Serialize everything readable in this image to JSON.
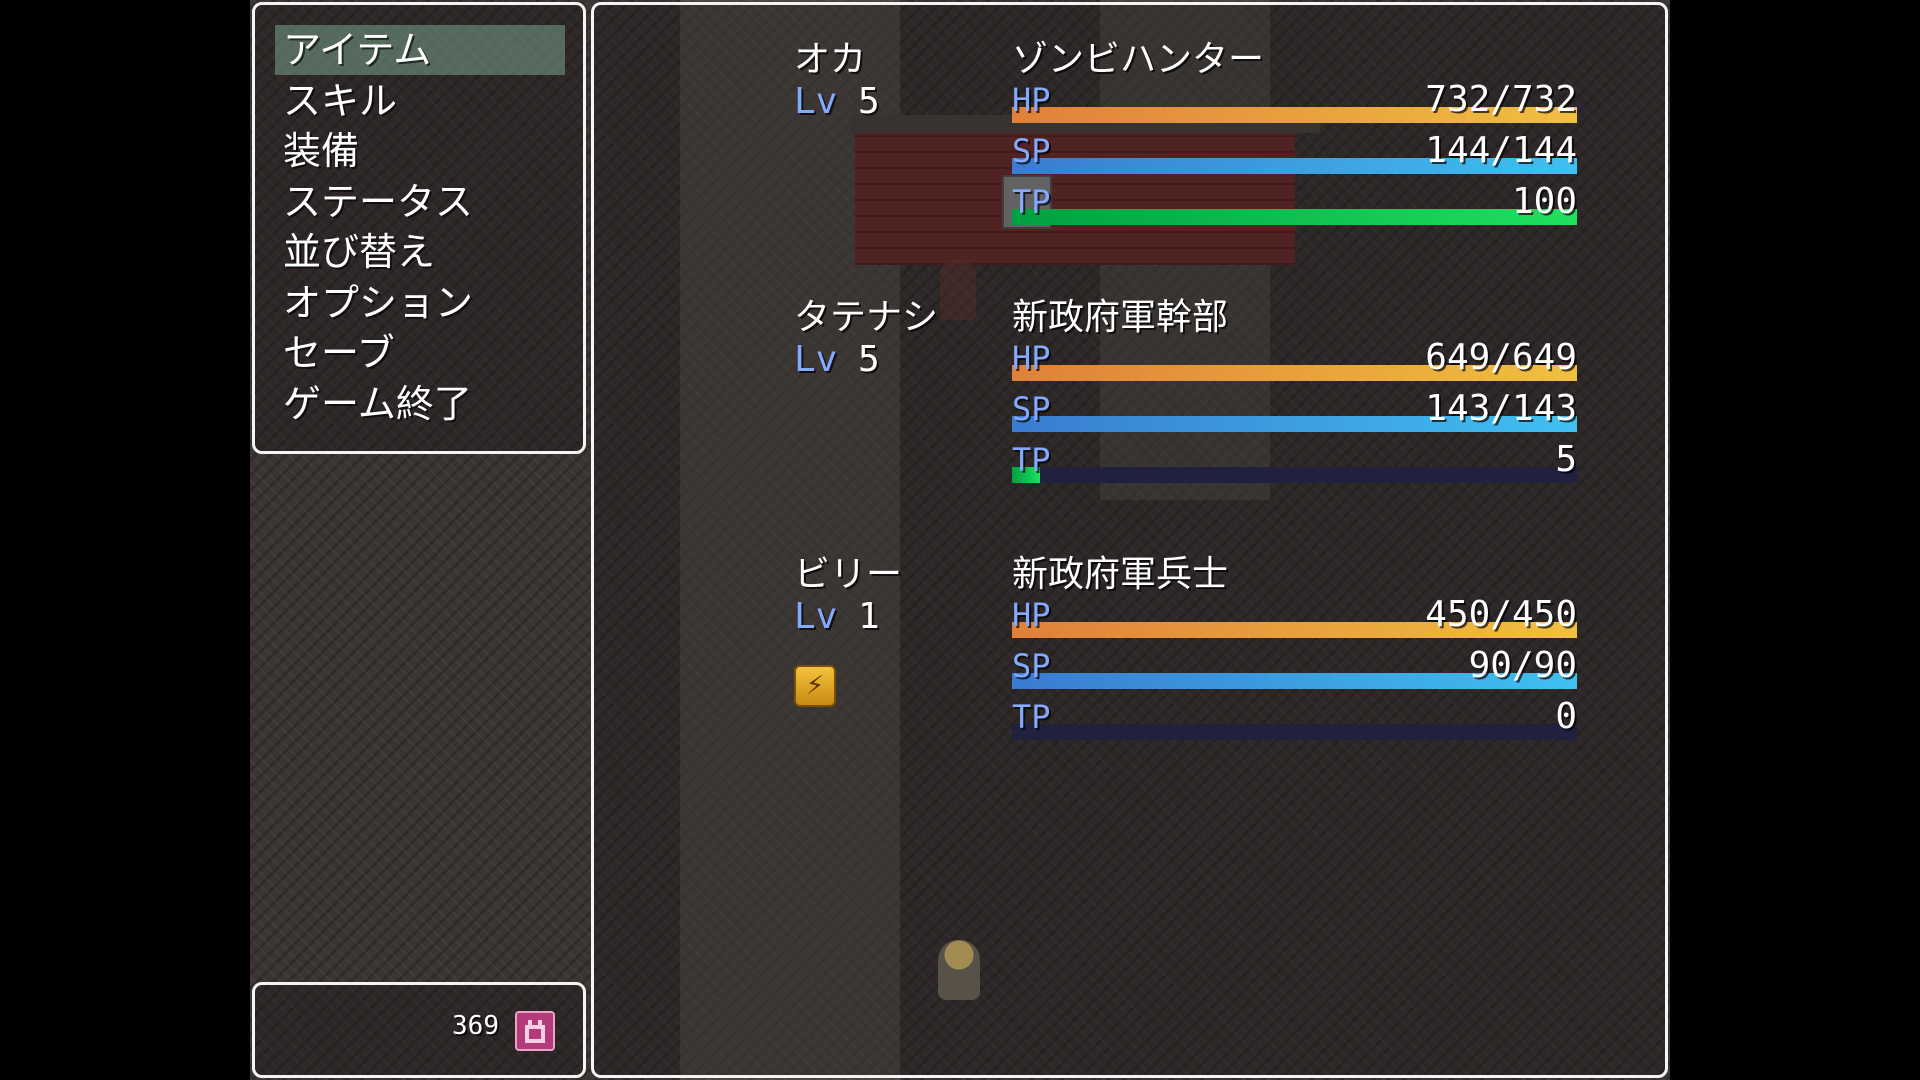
{
  "menu": {
    "items": [
      {
        "label": "アイテム",
        "selected": true
      },
      {
        "label": "スキル"
      },
      {
        "label": "装備"
      },
      {
        "label": "ステータス"
      },
      {
        "label": "並び替え"
      },
      {
        "label": "オプション"
      },
      {
        "label": "セーブ"
      },
      {
        "label": "ゲーム終了"
      }
    ]
  },
  "gold": {
    "value": "369",
    "icon": "money-bag-icon"
  },
  "party": [
    {
      "name": "オカ",
      "class": "ゾンビハンター",
      "lv_label": "Lv",
      "level": "5",
      "hp": {
        "label": "HP",
        "text": "732/732",
        "ratio": 1.0
      },
      "sp": {
        "label": "SP",
        "text": "144/144",
        "ratio": 1.0
      },
      "tp": {
        "label": "TP",
        "text": "100",
        "ratio": 1.0
      },
      "states": []
    },
    {
      "name": "タテナシ",
      "class": "新政府軍幹部",
      "lv_label": "Lv",
      "level": "5",
      "hp": {
        "label": "HP",
        "text": "649/649",
        "ratio": 1.0
      },
      "sp": {
        "label": "SP",
        "text": "143/143",
        "ratio": 1.0
      },
      "tp": {
        "label": "TP",
        "text": "5",
        "ratio": 0.05
      },
      "states": []
    },
    {
      "name": "ビリー",
      "class": "新政府軍兵士",
      "lv_label": "Lv",
      "level": "1",
      "hp": {
        "label": "HP",
        "text": "450/450",
        "ratio": 1.0
      },
      "sp": {
        "label": "SP",
        "text": "90/90",
        "ratio": 1.0
      },
      "tp": {
        "label": "TP",
        "text": "0",
        "ratio": 0.0
      },
      "states": [
        "lightning-state-icon"
      ]
    }
  ],
  "colors": {
    "hp_start": "#e0803a",
    "hp_end": "#f0c040",
    "sp_start": "#3a7cd0",
    "sp_end": "#40c0f0",
    "tp_start": "#00a040",
    "tp_end": "#20e060",
    "gauge_back": "#20203f",
    "system_blue": "#84aaff"
  }
}
